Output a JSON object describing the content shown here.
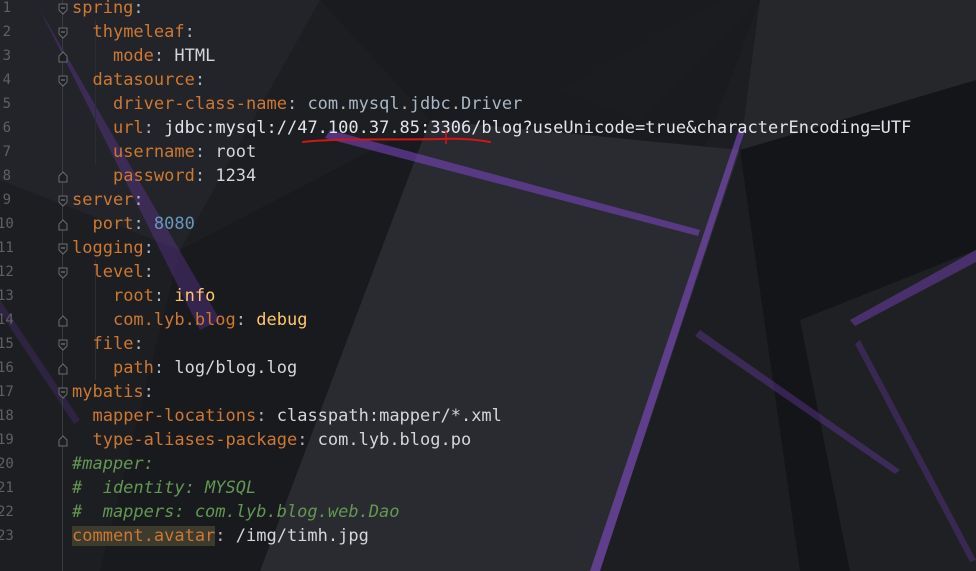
{
  "editor": {
    "line_numbers": [
      "1",
      "2",
      "3",
      "4",
      "5",
      "6",
      "7",
      "8",
      "9",
      "10",
      "11",
      "12",
      "13",
      "14",
      "15",
      "16",
      "17",
      "18",
      "19",
      "20",
      "21",
      "22",
      "23"
    ],
    "lines": [
      {
        "key": "spring",
        "sep": ":",
        "val": ""
      },
      {
        "key": "thymeleaf",
        "sep": ":",
        "val": ""
      },
      {
        "key": "mode",
        "sep": ": ",
        "val": "HTML"
      },
      {
        "key": "datasource",
        "sep": ":",
        "val": ""
      },
      {
        "key": "driver-class-name",
        "sep": ": ",
        "val": "com.mysql.jdbc.Driver"
      },
      {
        "key": "url",
        "sep": ": ",
        "val": "jdbc:mysql://47.100.37.85:3306/blog?useUnicode=true&characterEncoding=UTF"
      },
      {
        "key": "username",
        "sep": ": ",
        "val": "root"
      },
      {
        "key": "password",
        "sep": ": ",
        "val": "1234"
      },
      {
        "key": "server",
        "sep": ":",
        "val": ""
      },
      {
        "key": "port",
        "sep": ": ",
        "val": "8080"
      },
      {
        "key": "logging",
        "sep": ":",
        "val": ""
      },
      {
        "key": "level",
        "sep": ":",
        "val": ""
      },
      {
        "key": "root",
        "sep": ": ",
        "val": "info"
      },
      {
        "key": "com.lyb.blog",
        "sep": ": ",
        "val": "debug"
      },
      {
        "key": "file",
        "sep": ":",
        "val": ""
      },
      {
        "key": "path",
        "sep": ": ",
        "val": "log/blog.log"
      },
      {
        "key": "mybatis",
        "sep": ":",
        "val": ""
      },
      {
        "key": "mapper-locations",
        "sep": ": ",
        "val": "classpath:mapper/*.xml"
      },
      {
        "key": "type-aliases-package",
        "sep": ": ",
        "val": "com.lyb.blog.po"
      },
      {
        "comment": "#mapper:"
      },
      {
        "comment": "#  identity: MYSQL"
      },
      {
        "comment": "#  mappers: com.lyb.blog.web.Dao"
      },
      {
        "key": "comment.avatar",
        "sep": ": ",
        "val": "/img/timh.jpg"
      }
    ]
  },
  "colors": {
    "background": "#1e1f22",
    "key": "#cc7832",
    "number": "#6897bb",
    "highlight_value": "#ffc66d",
    "comment": "#629755",
    "annotation": "#d01616"
  }
}
